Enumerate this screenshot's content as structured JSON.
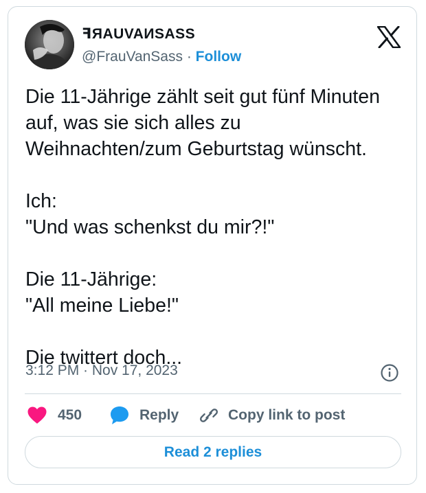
{
  "author": {
    "display_name": "ꟻЯAUVAИSASS",
    "handle": "@FrauVanSass",
    "separator": " · ",
    "follow_label": "Follow"
  },
  "tweet": {
    "text": "Die 11-Jährige zählt seit gut fünf Minuten\nauf, was sie sich alles zu\nWeihnachten/zum Geburtstag wünscht.\n\nIch:\n\"Und was schenkst du mir?!\"\n\nDie 11-Jährige:\n\"All meine Liebe!\"\n\nDie twittert doch...",
    "timestamp": "3:12 PM · Nov 17, 2023"
  },
  "actions": {
    "like_count": "450",
    "reply_label": "Reply",
    "copy_link_label": "Copy link to post"
  },
  "footer": {
    "read_replies_label": "Read 2 replies"
  },
  "icons": {
    "like": "heart-icon",
    "reply": "speech-bubble-icon",
    "copy": "link-icon",
    "info": "info-icon",
    "brand": "x-logo-icon"
  },
  "colors": {
    "like": "#f91880",
    "reply": "#1d9bf0",
    "link": "#1d8fd8",
    "secondary_text": "#536471",
    "border": "#cfd9de"
  }
}
